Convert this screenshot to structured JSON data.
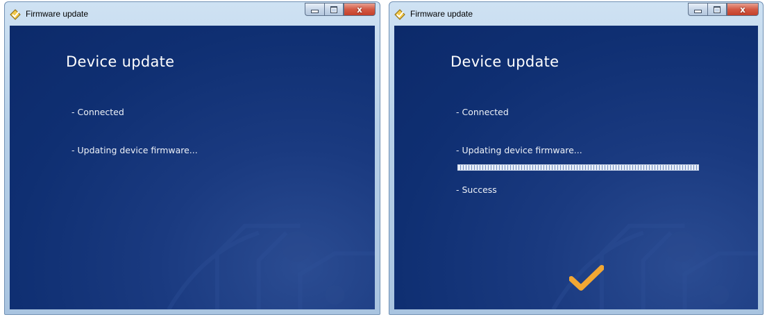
{
  "windows": [
    {
      "title": "Firmware update",
      "heading": "Device update",
      "status_connected": "- Connected",
      "status_updating": "- Updating device firmware...",
      "controls": {
        "minimize": "minimize",
        "maximize": "maximize",
        "close": "x"
      }
    },
    {
      "title": "Firmware update",
      "heading": "Device update",
      "status_connected": "- Connected",
      "status_updating": "- Updating device firmware...",
      "progress_percent": 100,
      "status_success": "- Success",
      "controls": {
        "minimize": "minimize",
        "maximize": "maximize",
        "close": "x"
      }
    }
  ],
  "colors": {
    "client_bg": "#0f2f72",
    "titlebar": "#b7d0e8",
    "close_button": "#d35a44",
    "checkmark": "#f2a733",
    "text": "#ffffff"
  },
  "icons": [
    "app-icon",
    "minimize-icon",
    "maximize-icon",
    "close-icon",
    "checkmark-icon"
  ]
}
